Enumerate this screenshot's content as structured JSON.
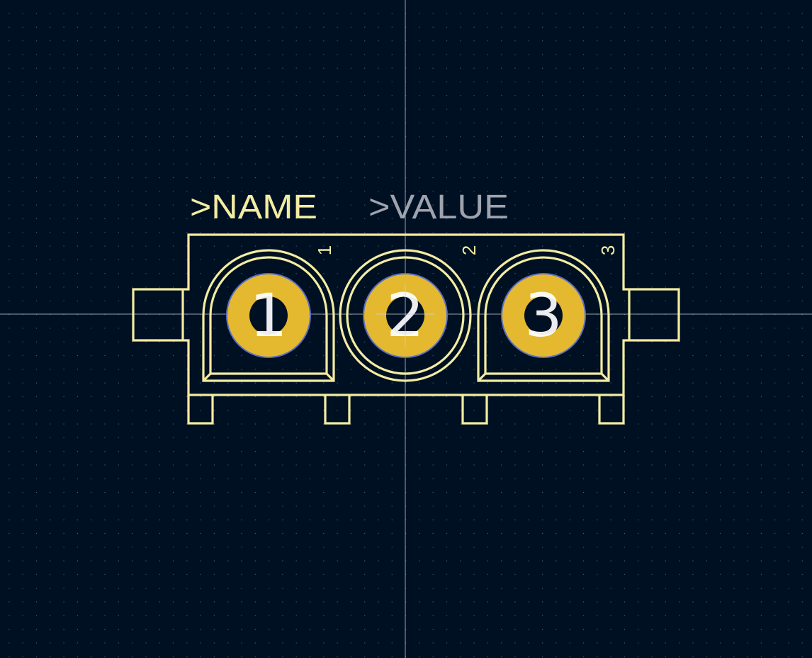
{
  "view": {
    "background_color": "#001023",
    "grid_dot_color": "#4a5a6e",
    "crosshair_color": "#c8d0dc",
    "grid": true
  },
  "footprint": {
    "silkscreen_color": "#f2eda1",
    "value_text_color": "#9ea3ad",
    "pad_color": "#e4b92f",
    "pad_outline_color": "#5b70c6",
    "drill_color": "#001023",
    "pad_number_color": "#ffffff",
    "name_field": ">NAME",
    "value_field": ">VALUE",
    "pin_markers": [
      "1",
      "2",
      "3"
    ],
    "pads": [
      {
        "number": "1"
      },
      {
        "number": "2"
      },
      {
        "number": "3"
      }
    ]
  }
}
